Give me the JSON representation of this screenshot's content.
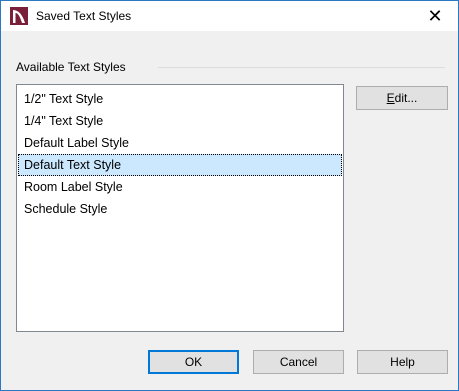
{
  "window": {
    "title": "Saved Text Styles",
    "close_glyph": "✕"
  },
  "group": {
    "label": "Available Text Styles"
  },
  "list": {
    "items": [
      {
        "label": "1/2\" Text Style"
      },
      {
        "label": "1/4\" Text Style"
      },
      {
        "label": "Default Label Style"
      },
      {
        "label": "Default Text Style",
        "selected": true
      },
      {
        "label": "Room Label Style"
      },
      {
        "label": "Schedule Style"
      }
    ]
  },
  "buttons": {
    "edit_mnemonic": "E",
    "edit_rest": "dit...",
    "ok": "OK",
    "cancel": "Cancel",
    "help": "Help"
  },
  "colors": {
    "selection": "#cce8ff",
    "window_border": "#2b79c2",
    "icon": "#7a1f3a"
  },
  "icons": {
    "app": "chief-architect-logo-icon",
    "close": "close-icon"
  }
}
